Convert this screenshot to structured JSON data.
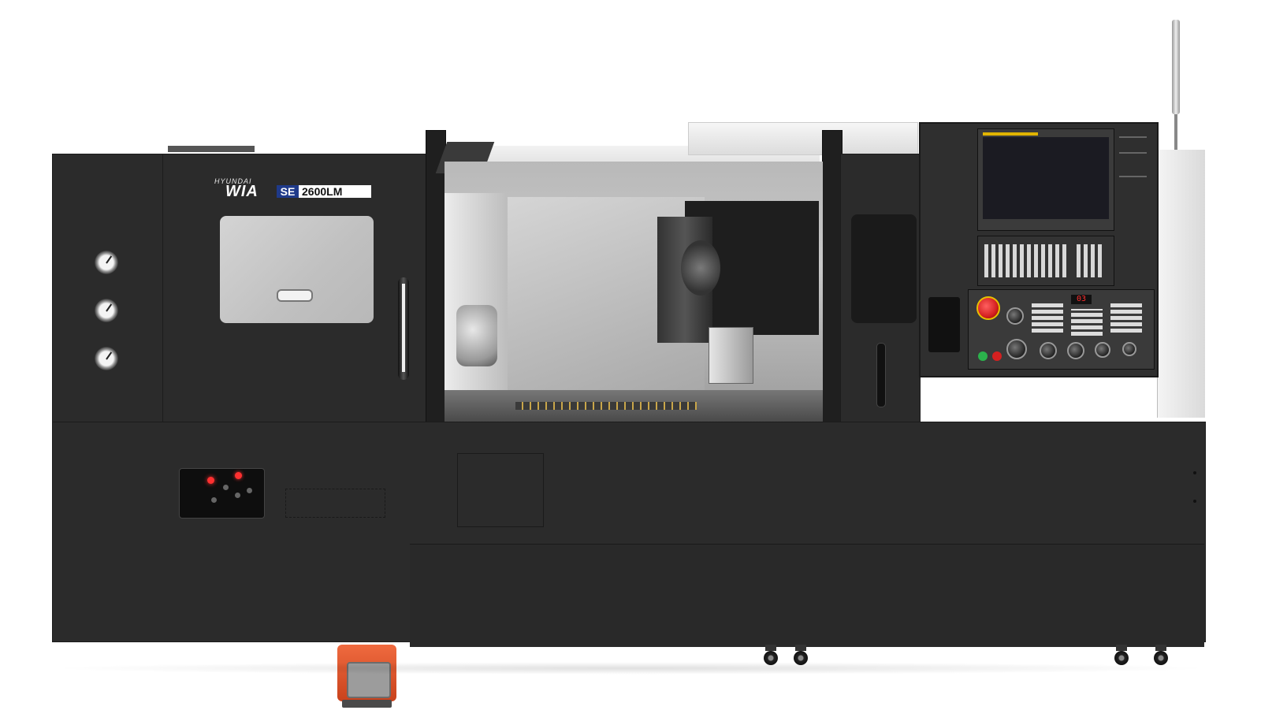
{
  "brand": {
    "maker": "HYUNDAI",
    "logo": "WIA",
    "series": "SE",
    "model": "2600LM"
  },
  "colors": {
    "body": "#2b2b2b",
    "cover_white": "#ededed",
    "series_badge": "#1f3a8a",
    "pedal_orange": "#e0522b",
    "emergency_stop": "#d42020",
    "indicator_red": "#ff3030"
  },
  "control_panel": {
    "spindle_load_display": "03",
    "icons": [
      "touch-screen-display",
      "qwerty-keypad",
      "emergency-stop-button",
      "feed-override-knob",
      "spindle-override-knob"
    ]
  }
}
